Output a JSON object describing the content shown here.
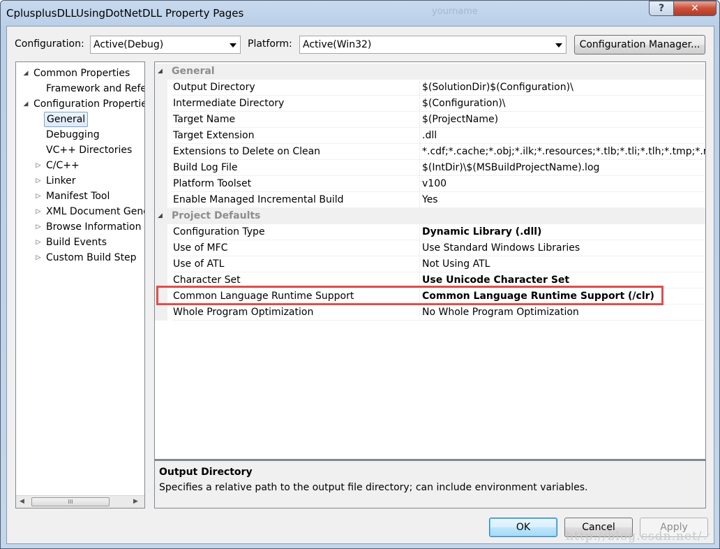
{
  "window": {
    "title": "CplusplusDLLUsingDotNetDLL Property Pages",
    "ghost_title": "yourname",
    "help_label": "?",
    "close_label": "✕"
  },
  "toolbar": {
    "configuration_label": "Configuration:",
    "configuration_value": "Active(Debug)",
    "platform_label": "Platform:",
    "platform_value": "Active(Win32)",
    "config_manager_label": "Configuration Manager..."
  },
  "tree": {
    "items": [
      {
        "label": "Common Properties",
        "expander": "◢"
      },
      {
        "label": "Framework and References",
        "expander": ""
      },
      {
        "label": "Configuration Properties",
        "expander": "◢"
      },
      {
        "label": "General",
        "expander": "",
        "selected": true
      },
      {
        "label": "Debugging",
        "expander": ""
      },
      {
        "label": "VC++ Directories",
        "expander": ""
      },
      {
        "label": "C/C++",
        "expander": "▷"
      },
      {
        "label": "Linker",
        "expander": "▷"
      },
      {
        "label": "Manifest Tool",
        "expander": "▷"
      },
      {
        "label": "XML Document Generator",
        "expander": "▷"
      },
      {
        "label": "Browse Information",
        "expander": "▷"
      },
      {
        "label": "Build Events",
        "expander": "▷"
      },
      {
        "label": "Custom Build Step",
        "expander": "▷"
      }
    ],
    "scroll_left": "◀",
    "scroll_right": "▶",
    "scroll_thumb": "III"
  },
  "grid": {
    "categories": [
      {
        "name": "General",
        "expander": "◢",
        "properties": [
          {
            "name": "Output Directory",
            "value": "$(SolutionDir)$(Configuration)\\",
            "bold": false
          },
          {
            "name": "Intermediate Directory",
            "value": "$(Configuration)\\",
            "bold": false
          },
          {
            "name": "Target Name",
            "value": "$(ProjectName)",
            "bold": false
          },
          {
            "name": "Target Extension",
            "value": ".dll",
            "bold": false
          },
          {
            "name": "Extensions to Delete on Clean",
            "value": "*.cdf;*.cache;*.obj;*.ilk;*.resources;*.tlb;*.tli;*.tlh;*.tmp;*.rsp;*.pgc",
            "bold": false
          },
          {
            "name": "Build Log File",
            "value": "$(IntDir)\\$(MSBuildProjectName).log",
            "bold": false
          },
          {
            "name": "Platform Toolset",
            "value": "v100",
            "bold": false
          },
          {
            "name": "Enable Managed Incremental Build",
            "value": "Yes",
            "bold": false
          }
        ]
      },
      {
        "name": "Project Defaults",
        "expander": "◢",
        "properties": [
          {
            "name": "Configuration Type",
            "value": "Dynamic Library (.dll)",
            "bold": true
          },
          {
            "name": "Use of MFC",
            "value": "Use Standard Windows Libraries",
            "bold": false
          },
          {
            "name": "Use of ATL",
            "value": "Not Using ATL",
            "bold": false
          },
          {
            "name": "Character Set",
            "value": "Use Unicode Character Set",
            "bold": true
          },
          {
            "name": "Common Language Runtime Support",
            "value": "Common Language Runtime Support (/clr)",
            "bold": true,
            "highlighted": true
          },
          {
            "name": "Whole Program Optimization",
            "value": "No Whole Program Optimization",
            "bold": false
          }
        ]
      }
    ]
  },
  "description": {
    "title": "Output Directory",
    "text": "Specifies a relative path to the output file directory; can include environment variables."
  },
  "buttons": {
    "ok": "OK",
    "cancel": "Cancel",
    "apply": "Apply"
  },
  "watermark": "http://blog.csdn.net/",
  "colors": {
    "highlight_border": "#e04d4d",
    "selection": "#dbeafb",
    "category_text": "#8d8d8d"
  }
}
